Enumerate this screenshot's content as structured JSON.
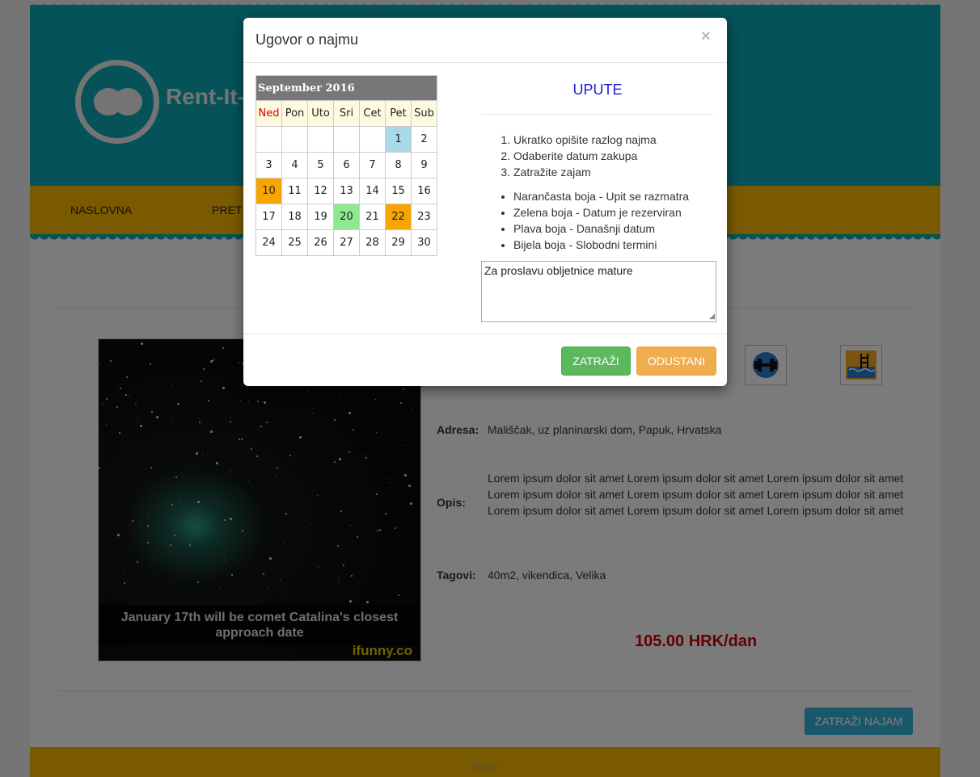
{
  "site": {
    "logo_text": "Rent-It-",
    "nav": [
      "NASLOVNA",
      "PRET"
    ],
    "footer_text": "footer"
  },
  "listing": {
    "photo_caption": "January 17th will be comet Catalina's closest approach date",
    "photo_watermark": "ifunny.co",
    "amenities": [
      "gym-icon",
      "pool-icon"
    ],
    "details": {
      "adresa_label": "Adresa:",
      "adresa_value": "Mališčak, uz planinarski dom, Papuk, Hrvatska",
      "opis_label": "Opis:",
      "opis_value": "Lorem ipsum dolor sit amet Lorem ipsum dolor sit amet Lorem ipsum dolor sit amet Lorem ipsum dolor sit amet Lorem ipsum dolor sit amet Lorem ipsum dolor sit amet Lorem ipsum dolor sit amet Lorem ipsum dolor sit amet Lorem ipsum dolor sit amet",
      "tagovi_label": "Tagovi:",
      "tagovi_value": "40m2, vikendica, Velika"
    },
    "price": "105.00 HRK/dan",
    "rent_button": "ZATRAŽI NAJAM"
  },
  "modal": {
    "title": "Ugovor o najmu",
    "close": "×",
    "calendar": {
      "month": "September 2016",
      "day_headers": [
        "Ned",
        "Pon",
        "Uto",
        "Sri",
        "Cet",
        "Pet",
        "Sub"
      ],
      "weeks": [
        [
          "",
          "",
          "",
          "",
          "",
          "1",
          "2"
        ],
        [
          "3",
          "4",
          "5",
          "6",
          "7",
          "8",
          "9"
        ],
        [
          "10",
          "11",
          "12",
          "13",
          "14",
          "15",
          "16"
        ],
        [
          "17",
          "18",
          "19",
          "20",
          "21",
          "22",
          "23"
        ],
        [
          "24",
          "25",
          "26",
          "27",
          "28",
          "29",
          "30"
        ]
      ],
      "highlights": {
        "1": "blue",
        "10": "orange",
        "20": "green",
        "22": "orange"
      },
      "colors": {
        "orange": "#f7a500",
        "green": "#8fe88f",
        "blue": "#a9d8e6"
      }
    },
    "upute_title": "UPUTE",
    "steps": [
      "Ukratko opišite razlog najma",
      "Odaberite datum zakupa",
      "Zatražite zajam"
    ],
    "legend": [
      "Narančasta boja - Upit se razmatra",
      "Zelena boja - Datum je rezerviran",
      "Plava boja - Današnji datum",
      "Bijela boja - Slobodni termini"
    ],
    "textarea_value": "Za proslavu obljetnice mature",
    "submit_button": "ZATRAŽI",
    "cancel_button": "ODUSTANI"
  }
}
